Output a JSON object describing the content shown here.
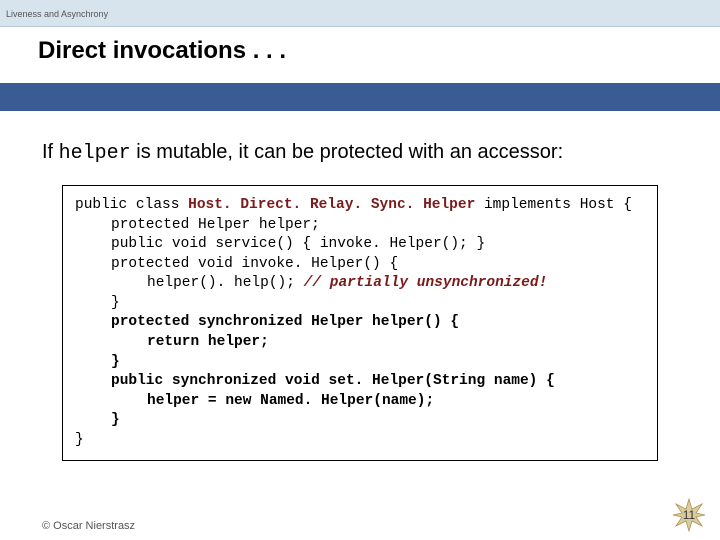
{
  "header": {
    "breadcrumb": "Liveness and Asynchrony",
    "title": "Direct invocations . . ."
  },
  "content": {
    "intro_prefix": "If ",
    "intro_code": "helper",
    "intro_suffix": " is mutable, it can be protected with an accessor:"
  },
  "code": {
    "l1a": "public class ",
    "l1b": "Host. Direct. Relay. Sync. Helper",
    "l1c": " implements Host {",
    "l2": "protected Helper helper;",
    "l3": "public void service() { invoke. Helper(); }",
    "l4": "protected void invoke. Helper() {",
    "l5a": "helper(). help();    ",
    "l5b": "// partially unsynchronized!",
    "l6": "}",
    "l7": "protected synchronized Helper helper() {",
    "l8": "return helper;",
    "l9": "}",
    "l10": "public synchronized void set. Helper(String name) {",
    "l11": "helper = new Named. Helper(name);",
    "l12": "}",
    "l13": "}"
  },
  "footer": {
    "copyright": "© Oscar Nierstrasz",
    "page": "11"
  }
}
